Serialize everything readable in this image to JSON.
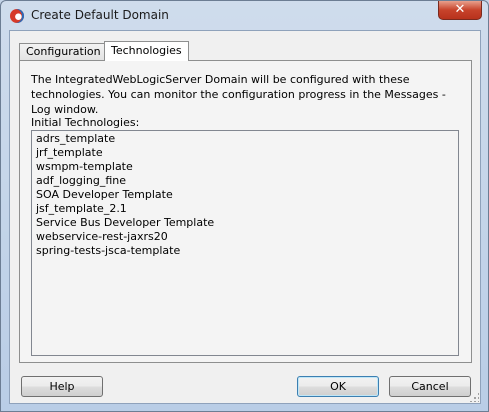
{
  "window": {
    "title": "Create Default Domain",
    "close_label": "✕"
  },
  "tabs": [
    {
      "label": "Configuration"
    },
    {
      "label": "Technologies"
    }
  ],
  "panel": {
    "description": "The IntegratedWebLogicServer Domain will be configured with these technologies.  You can monitor the configuration progress in the Messages - Log window.",
    "list_label": "Initial Technologies:",
    "items": [
      "adrs_template",
      "jrf_template",
      "wsmpm-template",
      "adf_logging_fine",
      "SOA Developer Template",
      "jsf_template_2.1",
      "Service Bus Developer Template",
      "webservice-rest-jaxrs20",
      "spring-tests-jsca-template"
    ]
  },
  "buttons": {
    "help": "Help",
    "ok": "OK",
    "cancel": "Cancel"
  }
}
